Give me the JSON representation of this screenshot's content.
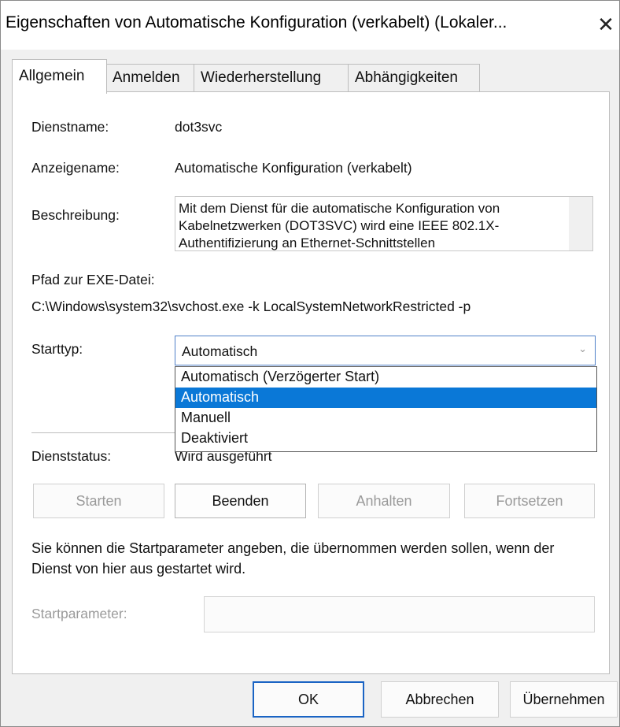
{
  "window": {
    "title": "Eigenschaften von Automatische Konfiguration (verkabelt) (Lokaler...",
    "close_glyph": "✕"
  },
  "tabs": [
    {
      "label": "Allgemein"
    },
    {
      "label": "Anmelden"
    },
    {
      "label": "Wiederherstellung"
    },
    {
      "label": "Abhängigkeiten"
    }
  ],
  "general": {
    "service_name_label": "Dienstname:",
    "service_name_value": "dot3svc",
    "display_name_label": "Anzeigename:",
    "display_name_value": "Automatische Konfiguration (verkabelt)",
    "description_label": "Beschreibung:",
    "description_value": "Mit dem Dienst für die automatische Konfiguration von Kabelnetzwerken (DOT3SVC) wird eine IEEE 802.1X-Authentifizierung an Ethernet-Schnittstellen",
    "exe_path_label": "Pfad zur EXE-Datei:",
    "exe_path_value": "C:\\Windows\\system32\\svchost.exe -k LocalSystemNetworkRestricted -p",
    "startup_type_label": "Starttyp:",
    "startup_type_value": "Automatisch",
    "startup_options": [
      "Automatisch (Verzögerter Start)",
      "Automatisch",
      "Manuell",
      "Deaktiviert"
    ],
    "service_status_label": "Dienststatus:",
    "service_status_value": "Wird ausgeführt",
    "buttons": {
      "start": "Starten",
      "stop": "Beenden",
      "pause": "Anhalten",
      "resume": "Fortsetzen"
    },
    "hint": "Sie können die Startparameter angeben, die übernommen werden sollen, wenn der Dienst von hier aus gestartet wird.",
    "start_params_label": "Startparameter:",
    "start_params_value": ""
  },
  "footer": {
    "ok": "OK",
    "cancel": "Abbrechen",
    "apply": "Übernehmen"
  },
  "colors": {
    "selection": "#0a78d7",
    "focus_border": "#1a64c4"
  }
}
